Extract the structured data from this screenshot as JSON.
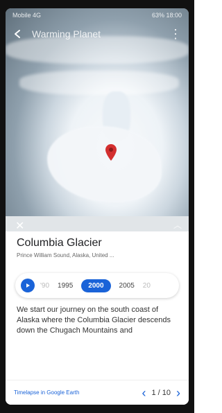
{
  "statusbar": {
    "left": "Mobile 4G",
    "right": "63% 18:00"
  },
  "appbar": {
    "back_icon": "arrow-left-icon",
    "title": "Warming Planet",
    "menu_icon": "more-vert-icon"
  },
  "place": {
    "title": "Columbia Glacier",
    "subtitle": "Prince William Sound, Alaska, United ..."
  },
  "timeline": {
    "years": [
      "'90",
      "1995",
      "2000",
      "2005",
      "20"
    ],
    "selected": "2000"
  },
  "description": "We start our journey on the south coast of Alaska where the Columbia Glacier descends down the Chugach Mountains and",
  "footer": {
    "link_label": "Timelapse in Google Earth",
    "page": "1 / 10"
  }
}
